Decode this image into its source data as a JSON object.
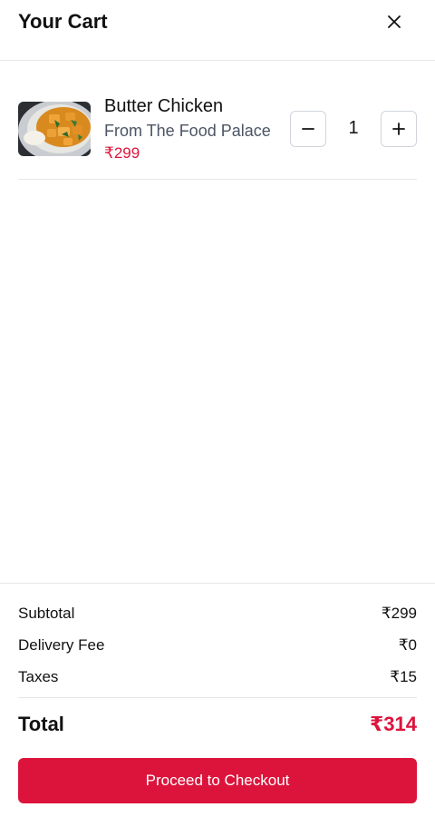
{
  "header": {
    "title": "Your Cart",
    "close_icon": "close-icon"
  },
  "cart": {
    "items": [
      {
        "name": "Butter Chicken",
        "source": "From The Food Palace",
        "price": "₹299",
        "quantity": "1",
        "decrease_icon": "minus-icon",
        "increase_icon": "plus-icon"
      }
    ]
  },
  "summary": {
    "subtotal_label": "Subtotal",
    "subtotal_value": "₹299",
    "delivery_label": "Delivery Fee",
    "delivery_value": "₹0",
    "taxes_label": "Taxes",
    "taxes_value": "₹15",
    "total_label": "Total",
    "total_value": "₹314"
  },
  "checkout": {
    "label": "Proceed to Checkout"
  },
  "colors": {
    "accent": "#dc143c",
    "muted_text": "#4b5563",
    "border": "#e5e7eb"
  }
}
